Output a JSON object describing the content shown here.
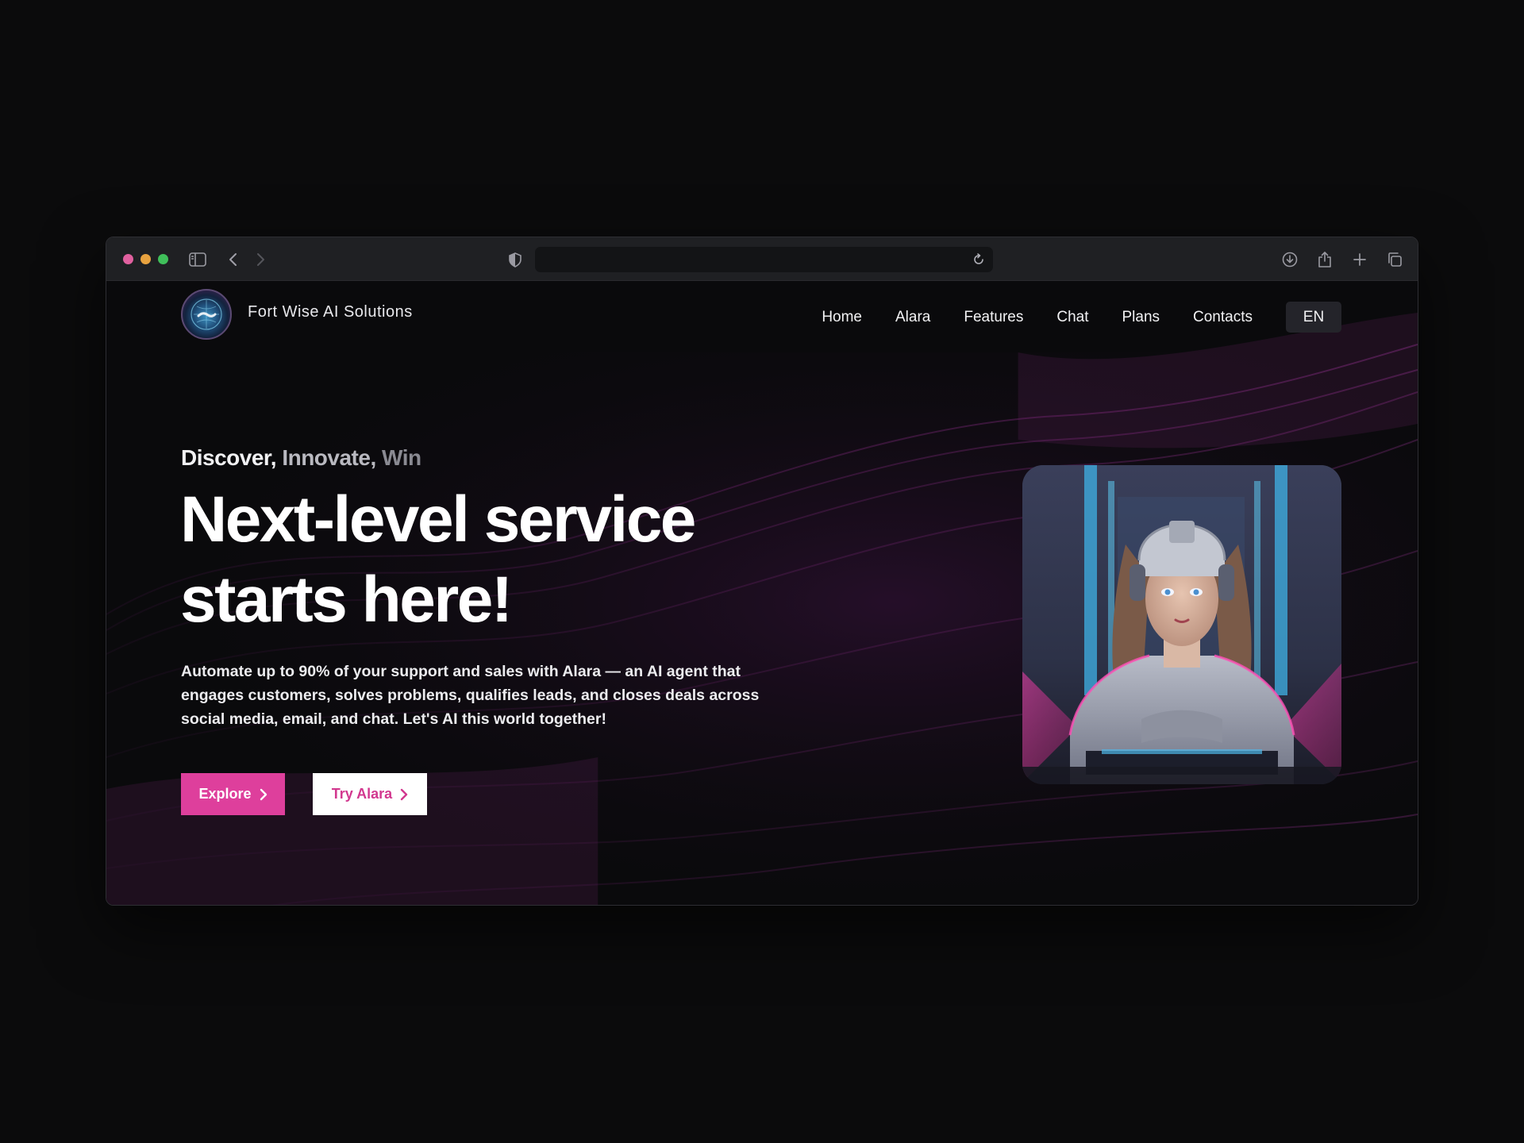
{
  "browser": {
    "traffic_colors": [
      "#e0609f",
      "#e8a23f",
      "#3fbf5a"
    ],
    "icons": [
      "sidebar-toggle-icon",
      "back-icon",
      "forward-icon",
      "privacy-shield-icon",
      "reload-icon",
      "download-icon",
      "share-icon",
      "new-tab-icon",
      "tabs-overview-icon"
    ]
  },
  "nav": {
    "brand": "Fort Wise AI Solutions",
    "items": [
      "Home",
      "Alara",
      "Features",
      "Chat",
      "Plans",
      "Contacts"
    ],
    "language": "EN"
  },
  "hero": {
    "eyebrow": [
      "Discover,",
      "Innovate,",
      "Win"
    ],
    "headline_line1": "Next-level service",
    "headline_line2": "starts here!",
    "description": "Automate up to 90% of your support and sales with Alara — an AI agent that engages customers, solves problems, qualifies leads, and closes deals across social media, email, and chat. Let's AI this world together!",
    "explore_label": "Explore",
    "try_label": "Try Alara"
  },
  "colors": {
    "accent": "#de3f9c",
    "accent_text": "#d2388f",
    "background": "#0a0a0c"
  }
}
